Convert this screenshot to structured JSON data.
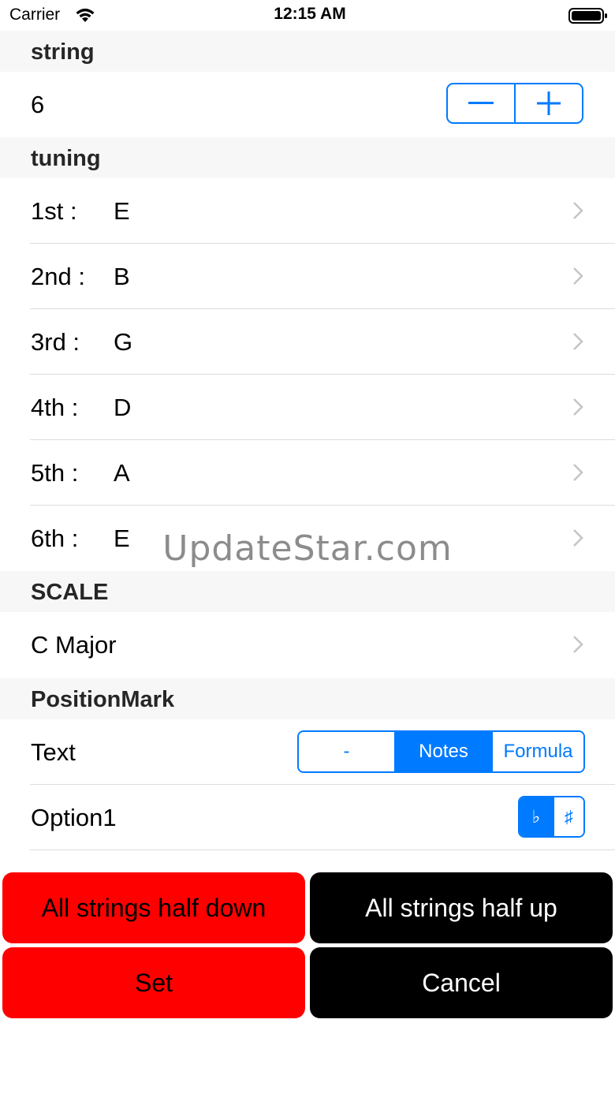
{
  "status_bar": {
    "carrier": "Carrier",
    "time": "12:15 AM",
    "wifi_icon": "wifi-icon",
    "battery_icon": "battery-full-icon"
  },
  "string_section": {
    "header": "string",
    "count": "6",
    "stepper": {
      "minus_icon": "minus-icon",
      "plus_icon": "plus-icon"
    }
  },
  "tuning_section": {
    "header": "tuning",
    "strings": [
      {
        "label": "1st :",
        "note": "E"
      },
      {
        "label": "2nd :",
        "note": "B"
      },
      {
        "label": "3rd :",
        "note": "G"
      },
      {
        "label": "4th :",
        "note": "D"
      },
      {
        "label": "5th :",
        "note": "A"
      },
      {
        "label": "6th :",
        "note": "E"
      }
    ]
  },
  "scale_section": {
    "header": "SCALE",
    "value": "C Major"
  },
  "position_mark_section": {
    "header": "PositionMark",
    "text_row": {
      "label": "Text",
      "options": [
        "-",
        "Notes",
        "Formula"
      ],
      "selected": "Notes"
    },
    "option1_row": {
      "label": "Option1",
      "options": [
        "♭",
        "♯"
      ],
      "selected": "♭"
    }
  },
  "actions": {
    "half_down": "All strings half down",
    "half_up": "All strings half up",
    "set": "Set",
    "cancel": "Cancel"
  },
  "watermark": "UpdateStar.com",
  "colors": {
    "accent": "#007aff",
    "destructive": "#ff0000",
    "dark_button": "#000000",
    "header_bg": "#f7f7f7"
  }
}
